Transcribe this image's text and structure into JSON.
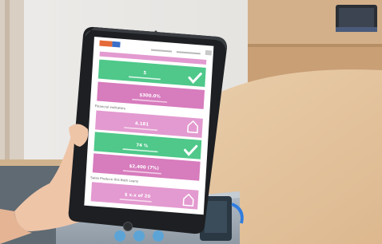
{
  "photo": {
    "description_free": true,
    "colors": {
      "wall": "#e9e7e4",
      "table": "#e6c7a0",
      "table_edge": "#c9a47c",
      "cabinet": "#d8b48e",
      "tablet_bezel": "#1d1f22",
      "screen_bg": "#ffffff",
      "card_green": "#4fc88a",
      "card_pink": "#d77cbd",
      "card_pink_light": "#e39ad0",
      "skin": "#f0c8ad",
      "phone": "#26353f",
      "box": "#9ea8b2"
    }
  },
  "tablet": {
    "app": {
      "logo_text": "",
      "header_link": "",
      "section_1_label": "Financial indicators",
      "section_2_label": "Sales Produce this Both Loans",
      "cards": [
        {
          "value": "5",
          "status": "check"
        },
        {
          "value": "$300.0%"
        },
        {
          "value": "4.181",
          "status": "home"
        },
        {
          "value": "74 %",
          "status": "check"
        },
        {
          "value": "$2,400 (7%)"
        },
        {
          "value": "$ x.x of 20",
          "status": "home"
        }
      ]
    }
  }
}
